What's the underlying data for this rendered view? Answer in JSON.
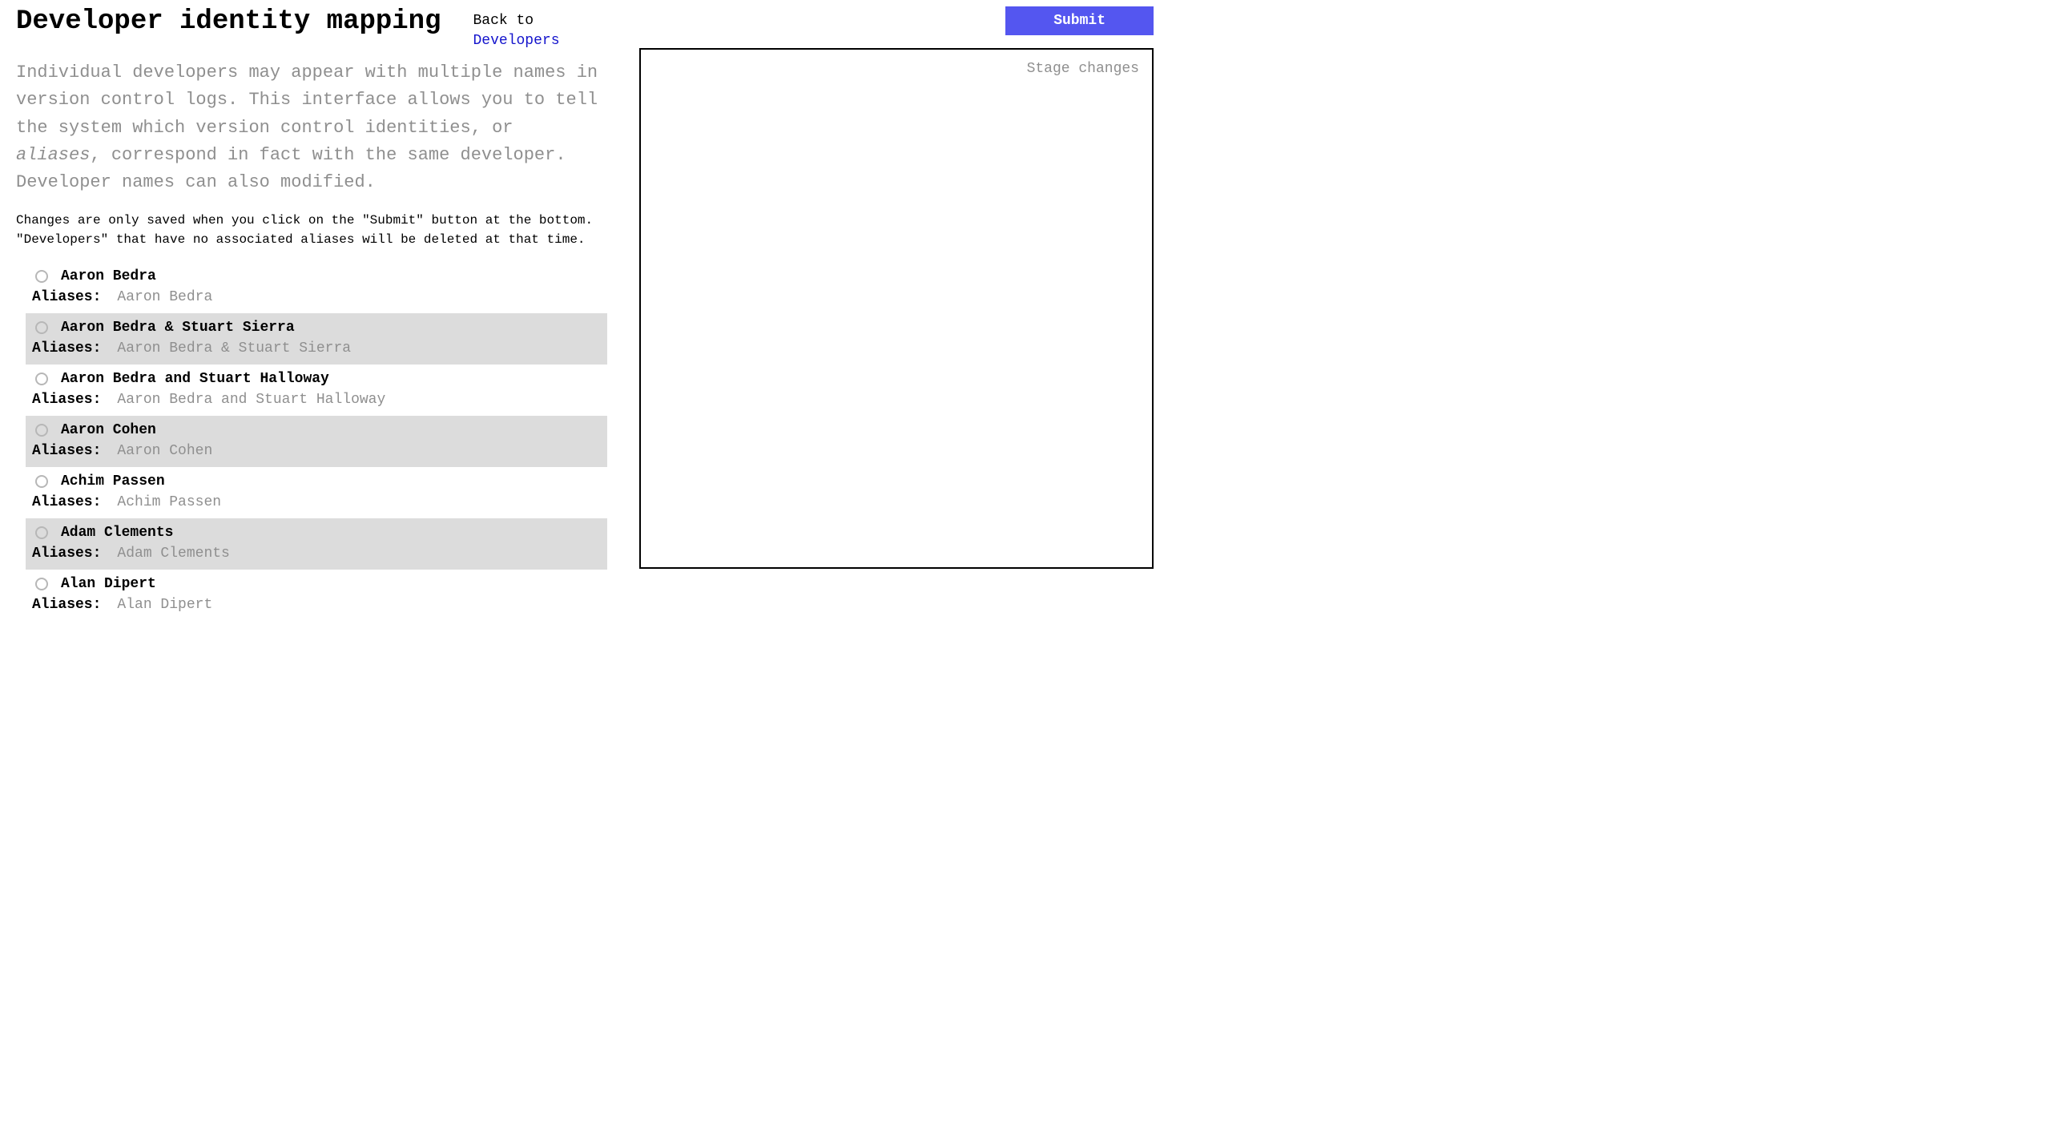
{
  "header": {
    "title": "Developer identity mapping",
    "back_label": "Back to",
    "back_link_text": "Developers"
  },
  "intro": {
    "pre": "Individual developers may appear with multiple names in version control logs. This interface allows you to tell the system which version control identities, or ",
    "em": "aliases",
    "post": ", correspond in fact with the same developer. Developer names can also modified."
  },
  "note_line1": "Changes are only saved when you click on the \"Submit\" button at the bottom.",
  "note_line2": "\"Developers\" that have no associated aliases will be deleted at that time.",
  "aliases_label": "Aliases:",
  "developers": [
    {
      "name": "Aaron Bedra",
      "aliases": "Aaron Bedra"
    },
    {
      "name": "Aaron Bedra & Stuart Sierra",
      "aliases": "Aaron Bedra & Stuart Sierra"
    },
    {
      "name": "Aaron Bedra and Stuart Halloway",
      "aliases": "Aaron Bedra and Stuart Halloway"
    },
    {
      "name": "Aaron Cohen",
      "aliases": "Aaron Cohen"
    },
    {
      "name": "Achim Passen",
      "aliases": "Achim Passen"
    },
    {
      "name": "Adam Clements",
      "aliases": "Adam Clements"
    },
    {
      "name": "Alan Dipert",
      "aliases": "Alan Dipert"
    }
  ],
  "right": {
    "submit_label": "Submit",
    "stage_title": "Stage changes"
  }
}
